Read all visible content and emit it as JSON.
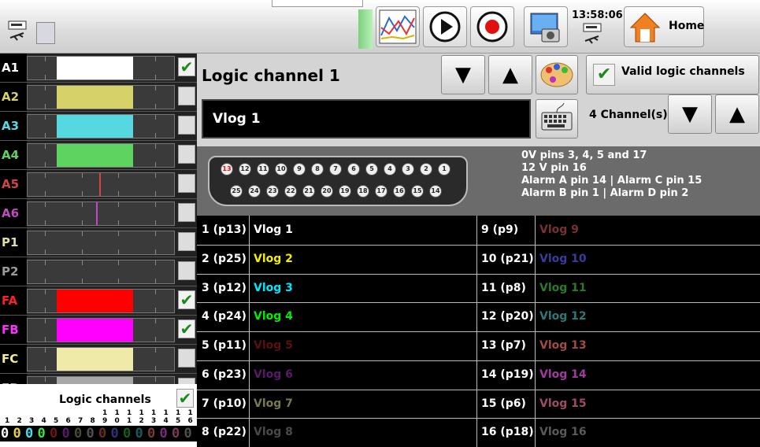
{
  "topbar": {
    "time": "13:58:06",
    "home_label": "Home"
  },
  "channels": [
    {
      "label": "A1",
      "color": "#ffffff",
      "checked": true,
      "fill": "#ffffff",
      "fill_start": 0.2,
      "fill_end": 0.72
    },
    {
      "label": "A2",
      "color": "#d7d16a",
      "checked": false,
      "fill": "#d7d16a",
      "fill_start": 0.2,
      "fill_end": 0.72
    },
    {
      "label": "A3",
      "color": "#56d8e0",
      "checked": false,
      "fill": "#56d8e0",
      "fill_start": 0.2,
      "fill_end": 0.72
    },
    {
      "label": "A4",
      "color": "#5fd35f",
      "checked": false,
      "fill": "#5fd35f",
      "fill_start": 0.2,
      "fill_end": 0.72
    },
    {
      "label": "A5",
      "color": "#d04545",
      "checked": false,
      "fill": "#d04545",
      "fill_start": 0.49,
      "fill_end": 0.5
    },
    {
      "label": "A6",
      "color": "#c04ac0",
      "checked": false,
      "fill": "#c04ac0",
      "fill_start": 0.47,
      "fill_end": 0.48
    },
    {
      "label": "P1",
      "color": "#e0dfa0",
      "checked": false,
      "fill": "",
      "fill_start": 0,
      "fill_end": 0
    },
    {
      "label": "P2",
      "color": "#9a9a9a",
      "checked": false,
      "fill": "",
      "fill_start": 0,
      "fill_end": 0
    },
    {
      "label": "FA",
      "color": "#ff2020",
      "checked": true,
      "fill": "#ff0000",
      "fill_start": 0.2,
      "fill_end": 0.72
    },
    {
      "label": "FB",
      "color": "#ff30ff",
      "checked": true,
      "fill": "#ff00ff",
      "fill_start": 0.2,
      "fill_end": 0.72
    },
    {
      "label": "FC",
      "color": "#f0eaa8",
      "checked": false,
      "fill": "#f0eaa8",
      "fill_start": 0.2,
      "fill_end": 0.72
    },
    {
      "label": "FD",
      "color": "#a8a8a8",
      "checked": false,
      "fill": "#a8a8a8",
      "fill_start": 0.2,
      "fill_end": 0.72
    }
  ],
  "logic": {
    "label": "Logic channels",
    "checked": true,
    "numbers_top": [
      "",
      "",
      "",
      "",
      "",
      "",
      "",
      "",
      "1",
      "1",
      "1",
      "1",
      "1",
      "1",
      "1",
      "1"
    ],
    "numbers_bottom": [
      "1",
      "2",
      "3",
      "4",
      "5",
      "6",
      "7",
      "8",
      "9",
      "0",
      "1",
      "2",
      "3",
      "4",
      "5",
      "6"
    ],
    "digits": [
      "0",
      "0",
      "0",
      "0",
      "0",
      "0",
      "0",
      "0",
      "0",
      "0",
      "0",
      "0",
      "0",
      "0",
      "0",
      "0"
    ],
    "digit_colors": [
      "#ffffff",
      "#e0d050",
      "#40e0f0",
      "#40e040",
      "#6a1818",
      "#5a1a6a",
      "#4a4a38",
      "#505050",
      "#6a2a2a",
      "#30307a",
      "#1a5a1a",
      "#1a5a5a",
      "#7a3a3a",
      "#7a2a7a",
      "#7a3a5a",
      "#505050"
    ]
  },
  "header": {
    "title": "Logic channel 1",
    "name_value": "Vlog  1",
    "valid_label": "Valid logic channels",
    "channel_count": "4 Channel(s)"
  },
  "connector": {
    "top_pins": [
      "13",
      "12",
      "11",
      "10",
      "9",
      "8",
      "7",
      "6",
      "5",
      "4",
      "3",
      "2",
      "1"
    ],
    "bottom_pins": [
      "25",
      "24",
      "23",
      "22",
      "21",
      "20",
      "19",
      "18",
      "17",
      "16",
      "15",
      "14"
    ],
    "info": [
      "0V pins 3, 4, 5 and 17",
      "12 V pin 16",
      "Alarm A pin 14 | Alarm C pin 15",
      "Alarm B pin 1 | Alarm D pin 2"
    ]
  },
  "rows_left": [
    {
      "pin": "1 (p13)",
      "name": "Vlog  1",
      "color": "#ffffff"
    },
    {
      "pin": "2 (p25)",
      "name": "Vlog  2",
      "color": "#f0f000"
    },
    {
      "pin": "3 (p12)",
      "name": "Vlog  3",
      "color": "#00e8ff"
    },
    {
      "pin": "4 (p24)",
      "name": "Vlog  4",
      "color": "#00f000"
    },
    {
      "pin": "5 (p11)",
      "name": "Vlog  5",
      "color": "#5a1010"
    },
    {
      "pin": "6 (p23)",
      "name": "Vlog  6",
      "color": "#5a1a6a"
    },
    {
      "pin": "7 (p10)",
      "name": "Vlog  7",
      "color": "#7a7a50"
    },
    {
      "pin": "8 (p22)",
      "name": "Vlog  8",
      "color": "#4a4a4a"
    }
  ],
  "rows_right": [
    {
      "pin": "9 (p9)",
      "name": "Vlog  9",
      "color": "#7a3030"
    },
    {
      "pin": "10 (p21)",
      "name": "Vlog 10",
      "color": "#3a3aa0"
    },
    {
      "pin": "11 (p8)",
      "name": "Vlog 11",
      "color": "#2a7a2a"
    },
    {
      "pin": "12 (p20)",
      "name": "Vlog 12",
      "color": "#2a7a7a"
    },
    {
      "pin": "13 (p7)",
      "name": "Vlog 13",
      "color": "#a04a4a"
    },
    {
      "pin": "14 (p19)",
      "name": "Vlog 14",
      "color": "#a03aa0"
    },
    {
      "pin": "15 (p6)",
      "name": "Vlog 15",
      "color": "#a04a6a"
    },
    {
      "pin": "16 (p18)",
      "name": "Vlog 16",
      "color": "#5a5a5a"
    }
  ]
}
